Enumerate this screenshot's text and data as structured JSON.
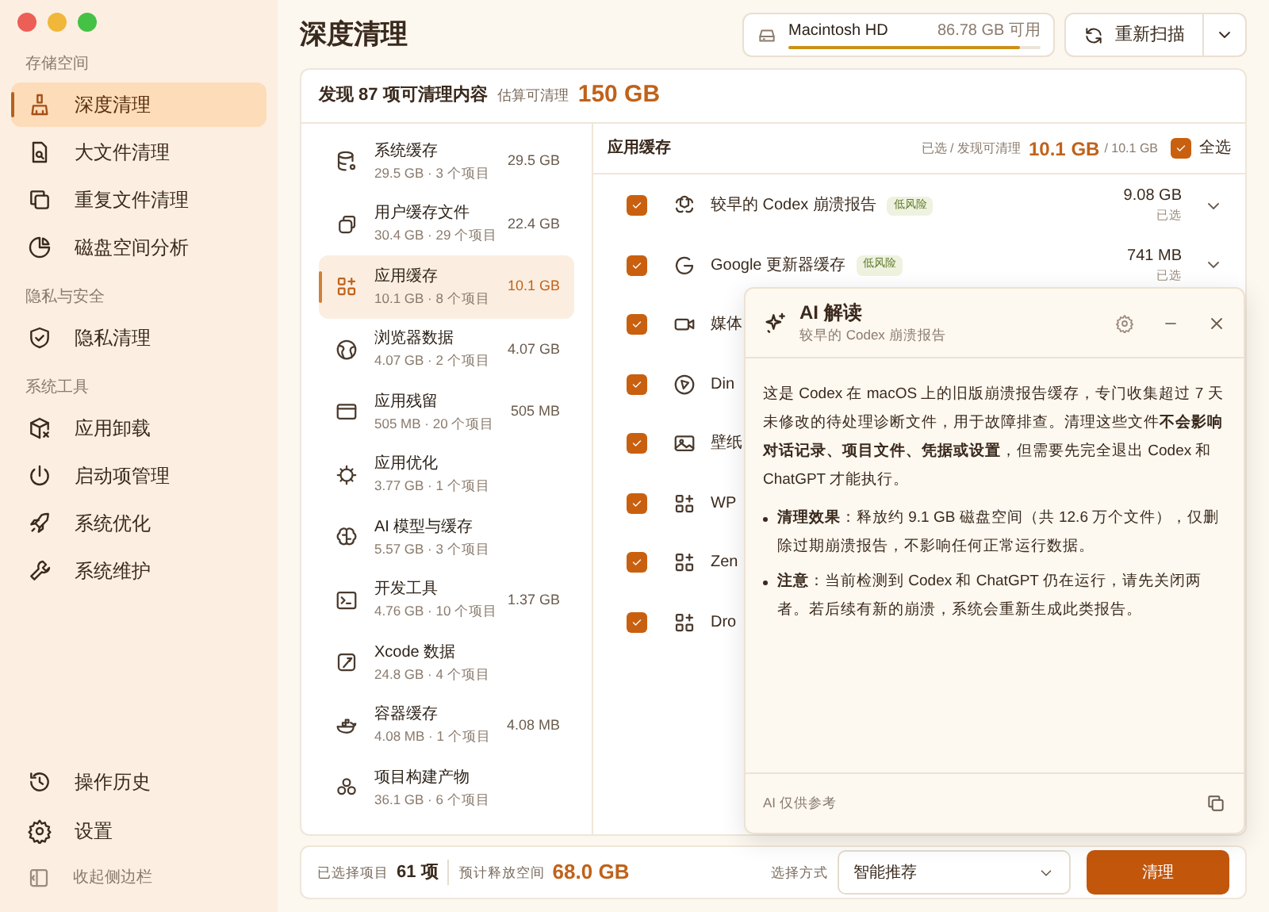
{
  "sidebar": {
    "sections": [
      {
        "title": "存储空间",
        "items": [
          {
            "label": "深度清理",
            "selected": true
          },
          {
            "label": "大文件清理",
            "selected": false
          },
          {
            "label": "重复文件清理",
            "selected": false
          },
          {
            "label": "磁盘空间分析",
            "selected": false
          }
        ]
      },
      {
        "title": "隐私与安全",
        "items": [
          {
            "label": "隐私清理",
            "selected": false
          }
        ]
      },
      {
        "title": "系统工具",
        "items": [
          {
            "label": "应用卸载",
            "selected": false
          },
          {
            "label": "启动项管理",
            "selected": false
          },
          {
            "label": "系统优化",
            "selected": false
          },
          {
            "label": "系统维护",
            "selected": false
          }
        ]
      }
    ],
    "footer_items": [
      "操作历史",
      "设置"
    ],
    "collapse": "收起侧边栏"
  },
  "header": {
    "title": "深度清理",
    "disk": {
      "name": "Macintosh HD",
      "free": "86.78 GB 可用",
      "level": 0.92
    },
    "rescan": "重新扫描"
  },
  "summary": {
    "found": "发现 87 项可清理内容",
    "estimate_label": "估算可清理",
    "estimate": "150 GB"
  },
  "categories": [
    {
      "name": "系统缓存",
      "sub": "29.5 GB · 3 个项目",
      "size": "29.5 GB",
      "selected": false
    },
    {
      "name": "用户缓存文件",
      "sub": "30.4 GB · 29 个项目",
      "size": "22.4 GB",
      "selected": false
    },
    {
      "name": "应用缓存",
      "sub": "10.1 GB · 8 个项目",
      "size": "10.1 GB",
      "selected": true
    },
    {
      "name": "浏览器数据",
      "sub": "4.07 GB · 2 个项目",
      "size": "4.07 GB",
      "selected": false
    },
    {
      "name": "应用残留",
      "sub": "505 MB · 20 个项目",
      "size": "505 MB",
      "selected": false
    },
    {
      "name": "应用优化",
      "sub": "3.77 GB · 1 个项目",
      "selected": false
    },
    {
      "name": "AI 模型与缓存",
      "sub": "5.57 GB · 3 个项目",
      "selected": false
    },
    {
      "name": "开发工具",
      "sub": "4.76 GB · 10 个项目",
      "size": "1.37 GB",
      "selected": false
    },
    {
      "name": "Xcode 数据",
      "sub": "24.8 GB · 4 个项目",
      "selected": false
    },
    {
      "name": "容器缓存",
      "sub": "4.08 MB · 1 个项目",
      "size": "4.08 MB",
      "selected": false
    },
    {
      "name": "项目构建产物",
      "sub": "36.1 GB · 6 个项目",
      "selected": false
    }
  ],
  "detail": {
    "title": "应用缓存",
    "selected_label": "已选 / 发现可清理",
    "selected_size": "10.1 GB",
    "total": "/ 10.1 GB",
    "select_all": {
      "label": "全选",
      "checked": true
    },
    "items": [
      {
        "name": "较早的 Codex 崩溃报告",
        "badge": "低风险",
        "size": "9.08 GB",
        "state": "已选",
        "checked": true
      },
      {
        "name": "Google 更新器缓存",
        "badge": "低风险",
        "size": "741 MB",
        "state": "已选",
        "checked": true
      },
      {
        "name": "媒体",
        "checked": true
      },
      {
        "name": "Din",
        "checked": true
      },
      {
        "name": "壁纸",
        "checked": true
      },
      {
        "name": "WP",
        "checked": true
      },
      {
        "name": "Zen",
        "checked": true
      },
      {
        "name": "Dro",
        "checked": true
      }
    ]
  },
  "ai_panel": {
    "title": "AI 解读",
    "subtitle": "较早的 Codex 崩溃报告",
    "body": "这是 Codex 在 macOS 上的旧版崩溃报告缓存，专门收集超过 7 天未修改的待处理诊断文件，用于故障排查。清理这些文件**不会影响对话记录、项目文件、凭据或设置**，但需要先完全退出 Codex 和 ChatGPT 才能执行。",
    "bullets": [
      "**清理效果**：释放约 9.1 GB 磁盘空间（共 12.6 万个文件），仅删除过期崩溃报告，不影响任何正常运行数据。",
      "**注意**：当前检测到 Codex 和 ChatGPT 仍在运行，请先关闭两者。若后续有新的崩溃，系统会重新生成此类报告。"
    ],
    "footer": "AI 仅供参考"
  },
  "footer": {
    "selected_label": "已选择项目",
    "selected_count": "61 项",
    "free_label": "预计释放空间",
    "free": "68.0 GB",
    "mode_label": "选择方式",
    "mode": "智能推荐",
    "clean": "清理"
  }
}
